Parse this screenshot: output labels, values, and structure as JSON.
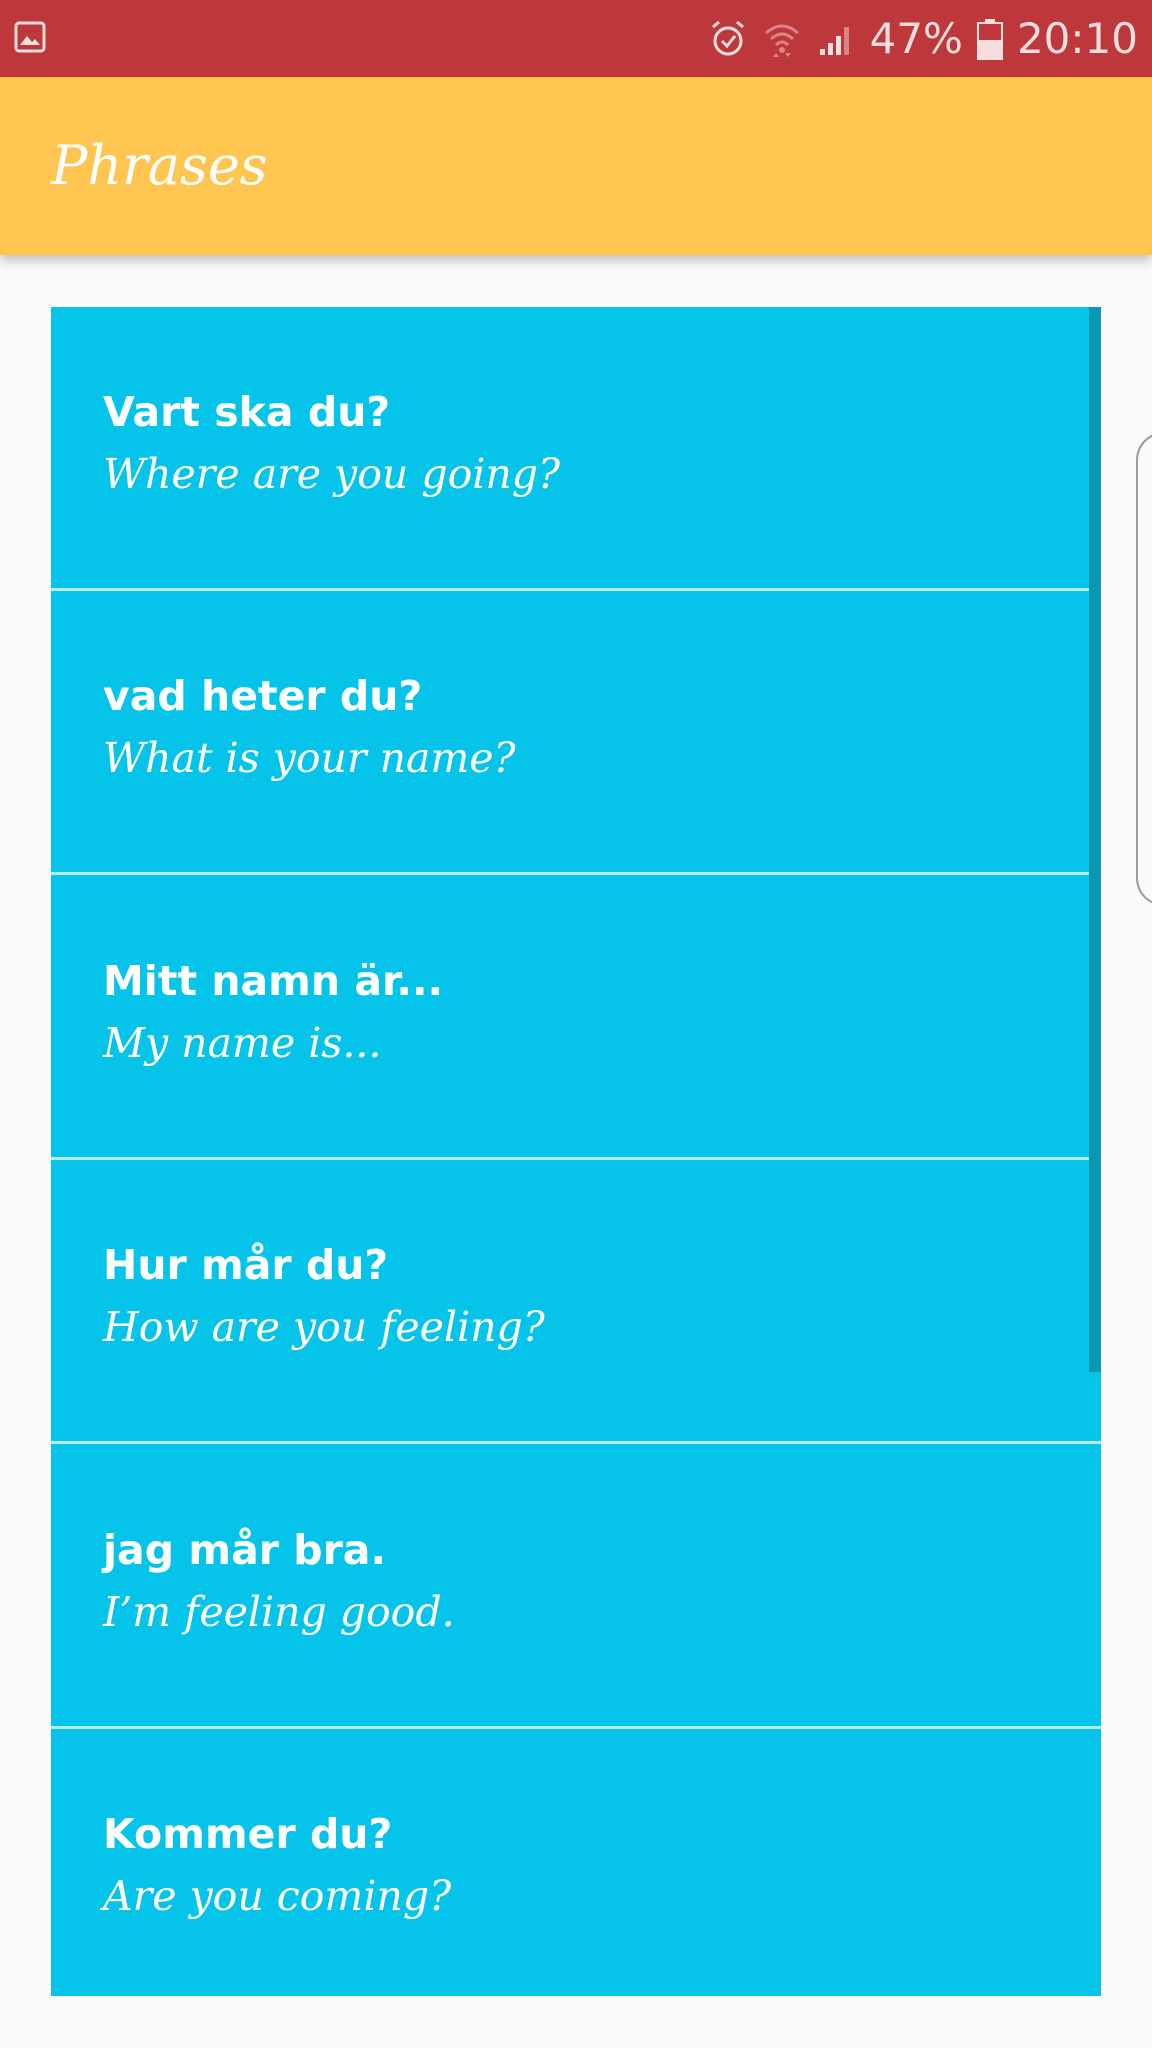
{
  "status_bar": {
    "battery": "47%",
    "time": "20:10",
    "icons": [
      "gallery-icon",
      "alarm-icon",
      "wifi-icon",
      "signal-icon",
      "battery-icon"
    ],
    "color": "#bc383b"
  },
  "app_bar": {
    "title": "Phrases",
    "color": "#fec551"
  },
  "list": {
    "color": "#06c4e9",
    "items": [
      {
        "phrase": "Vart ska du?",
        "translation": "Where are you going?"
      },
      {
        "phrase": "vad heter du?",
        "translation": "What is your name?"
      },
      {
        "phrase": "Mitt namn är...",
        "translation": "My name is..."
      },
      {
        "phrase": "Hur mår du?",
        "translation": "How are you feeling?"
      },
      {
        "phrase": "jag mår bra.",
        "translation": "I’m feeling good."
      },
      {
        "phrase": "Kommer du?",
        "translation": "Are you coming?"
      }
    ]
  }
}
